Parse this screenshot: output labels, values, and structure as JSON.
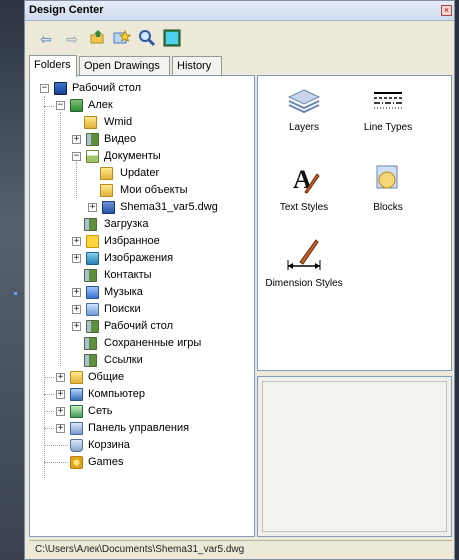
{
  "window": {
    "title": "Design Center"
  },
  "toolbar": {
    "buttons": [
      {
        "name": "back-button",
        "icon": "back-arrow-icon"
      },
      {
        "name": "forward-button",
        "icon": "forward-arrow-icon"
      },
      {
        "name": "up-button",
        "icon": "up-folder-icon"
      },
      {
        "name": "favorites-button",
        "icon": "favorites-icon"
      },
      {
        "name": "search-button",
        "icon": "search-icon"
      },
      {
        "name": "preview-button",
        "icon": "preview-icon"
      }
    ]
  },
  "tabs": [
    {
      "label": "Folders",
      "active": true
    },
    {
      "label": "Open Drawings",
      "active": false
    },
    {
      "label": "History",
      "active": false
    }
  ],
  "tree": {
    "root": "Рабочий стол",
    "user": "Алек",
    "items": [
      {
        "label": "Wmid"
      },
      {
        "label": "Видео"
      },
      {
        "label": "Документы"
      },
      {
        "label": "Updater"
      },
      {
        "label": "Мои объекты"
      },
      {
        "label": "Shema31_var5.dwg"
      },
      {
        "label": "Загрузка"
      },
      {
        "label": "Избранное"
      },
      {
        "label": "Изображения"
      },
      {
        "label": "Контакты"
      },
      {
        "label": "Музыка"
      },
      {
        "label": "Поиски"
      },
      {
        "label": "Рабочий стол"
      },
      {
        "label": "Сохраненные игры"
      },
      {
        "label": "Ссылки"
      },
      {
        "label": "Общие"
      },
      {
        "label": "Компьютер"
      },
      {
        "label": "Сеть"
      },
      {
        "label": "Панель управления"
      },
      {
        "label": "Корзина"
      },
      {
        "label": "Games"
      }
    ]
  },
  "content": {
    "items": [
      {
        "label": "Layers",
        "icon": "layers-icon"
      },
      {
        "label": "Line Types",
        "icon": "line-types-icon"
      },
      {
        "label": "Text Styles",
        "icon": "text-styles-icon"
      },
      {
        "label": "Blocks",
        "icon": "blocks-icon"
      },
      {
        "label": "Dimension Styles",
        "icon": "dimension-styles-icon"
      }
    ]
  },
  "status": {
    "path": "C:\\Users\\Алек\\Documents\\Shema31_var5.dwg"
  }
}
